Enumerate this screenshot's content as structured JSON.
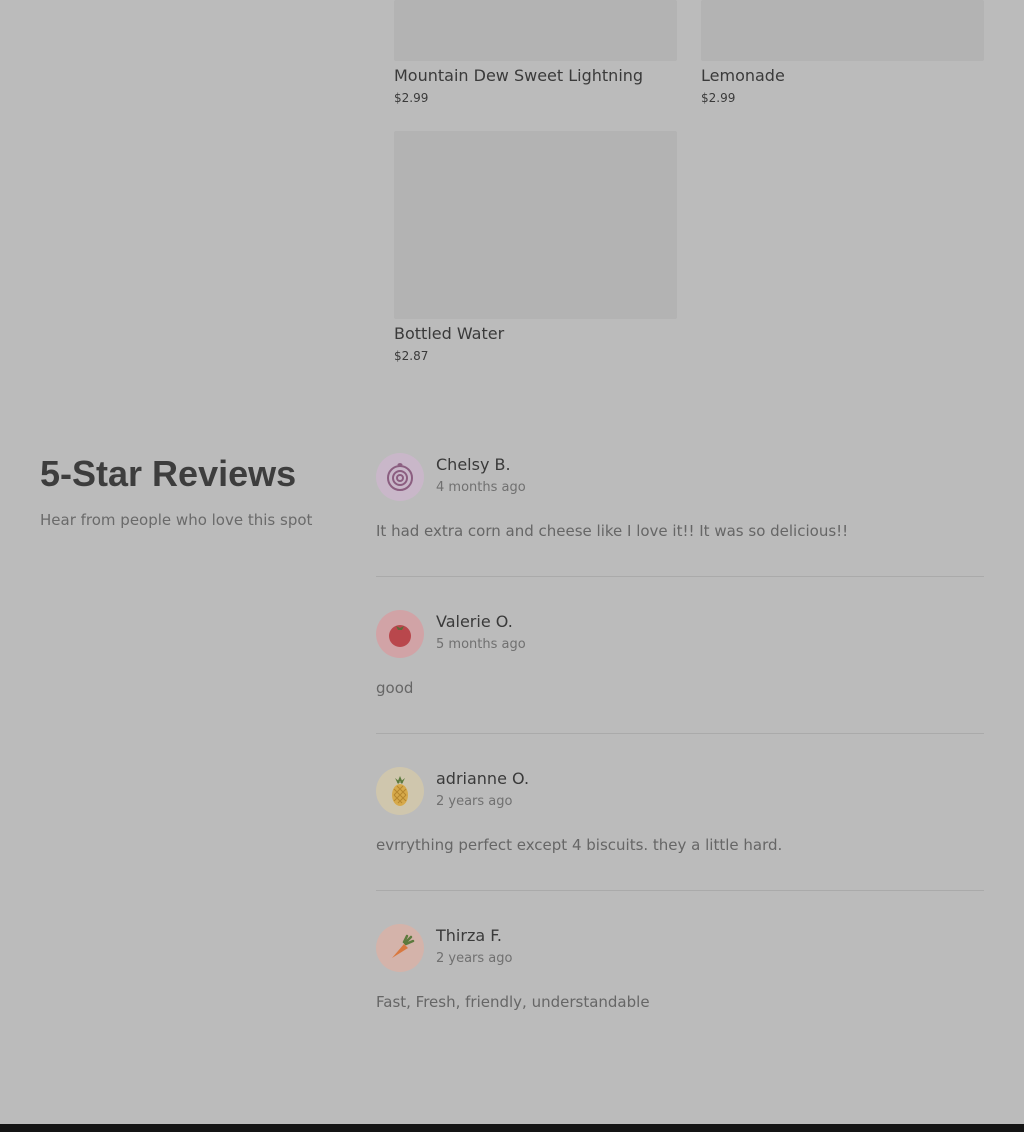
{
  "products": [
    {
      "name": "Mountain Dew Sweet Lightning",
      "price": "$2.99"
    },
    {
      "name": "Lemonade",
      "price": "$2.99"
    },
    {
      "name": "Bottled Water",
      "price": "$2.87"
    }
  ],
  "reviews_section": {
    "title": "5-Star Reviews",
    "subtitle": "Hear from people who love this spot",
    "reviews": [
      {
        "name": "Chelsy B.",
        "time": "4 months ago",
        "text": "It had extra corn and cheese like I love it!! It was so delicious!!",
        "avatar_icon": "onion-icon",
        "avatar_color": "#c9b7c9"
      },
      {
        "name": "Valerie O.",
        "time": "5 months ago",
        "text": "good",
        "avatar_icon": "tomato-icon",
        "avatar_color": "#d1a3a6"
      },
      {
        "name": "adrianne O.",
        "time": "2 years ago",
        "text": "evrrything perfect except 4 biscuits. they a little hard.",
        "avatar_icon": "pineapple-icon",
        "avatar_color": "#cfc6ad"
      },
      {
        "name": "Thirza F.",
        "time": "2 years ago",
        "text": "Fast, Fresh, friendly, understandable",
        "avatar_icon": "carrot-icon",
        "avatar_color": "#d4b3aa"
      }
    ]
  },
  "colors": {
    "background": "#bbbbbb",
    "footer": "#141414"
  }
}
